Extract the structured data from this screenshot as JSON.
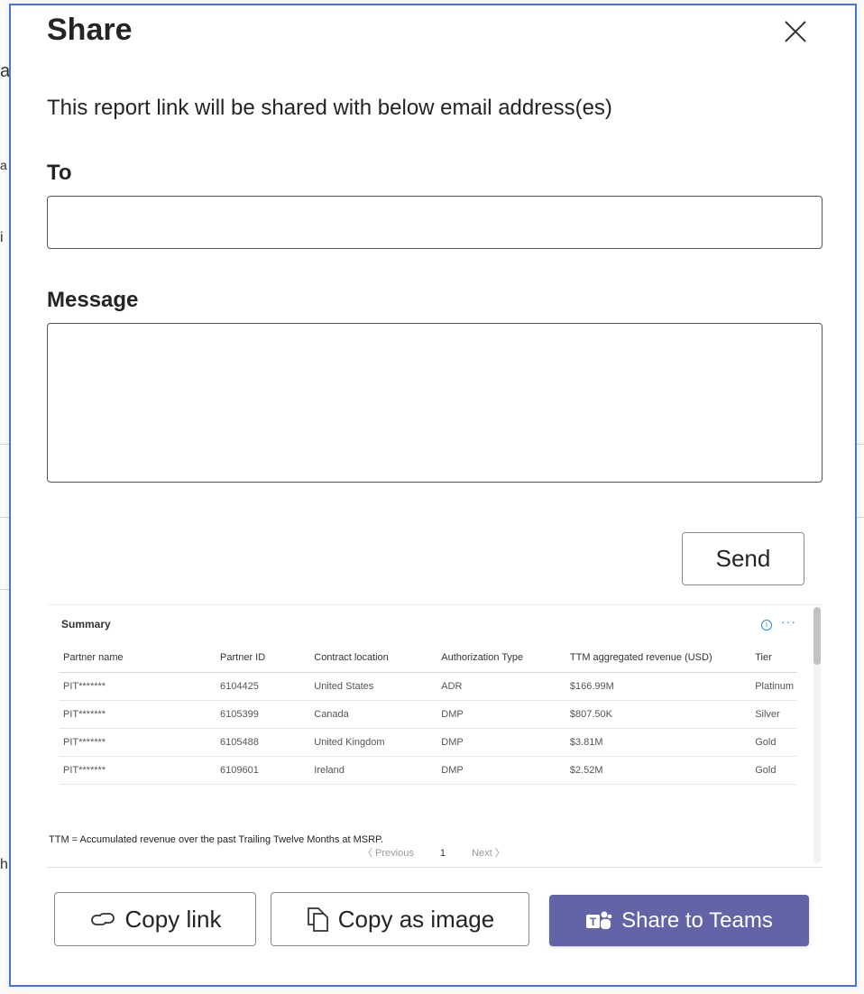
{
  "background": {
    "fragments": [
      "a",
      "a",
      "i",
      "h"
    ]
  },
  "dialog": {
    "title": "Share",
    "subtitle": "This report link will be shared with below email address(es)",
    "to_label": "To",
    "to_value": "",
    "message_label": "Message",
    "message_value": "",
    "send_label": "Send"
  },
  "preview": {
    "title": "Summary",
    "columns": [
      "Partner name",
      "Partner ID",
      "Contract location",
      "Authorization Type",
      "TTM aggregated revenue (USD)",
      "Tier"
    ],
    "rows": [
      [
        "PIT*******",
        "6104425",
        "United States",
        "ADR",
        "$166.99M",
        "Platinum"
      ],
      [
        "PIT*******",
        "6105399",
        "Canada",
        "DMP",
        "$807.50K",
        "Silver"
      ],
      [
        "PIT*******",
        "6105488",
        "United Kingdom",
        "DMP",
        "$3.81M",
        "Gold"
      ],
      [
        "PIT*******",
        "6109601",
        "Ireland",
        "DMP",
        "$2.52M",
        "Gold"
      ]
    ],
    "footnote": "TTM = Accumulated revenue over the past Trailing Twelve Months at MSRP.",
    "pager": {
      "previous": "〈 Previous",
      "page": "1",
      "next": "Next 〉"
    }
  },
  "actions": {
    "copy_link": "Copy link",
    "copy_image": "Copy as image",
    "share_teams": "Share to Teams"
  },
  "colors": {
    "dialog_border": "#4a76c7",
    "teams_purple": "#6264a7",
    "info_blue": "#2b88d8"
  },
  "icons": [
    "close-icon",
    "link-icon",
    "copy-icon",
    "teams-icon",
    "info-icon",
    "more-icon"
  ]
}
